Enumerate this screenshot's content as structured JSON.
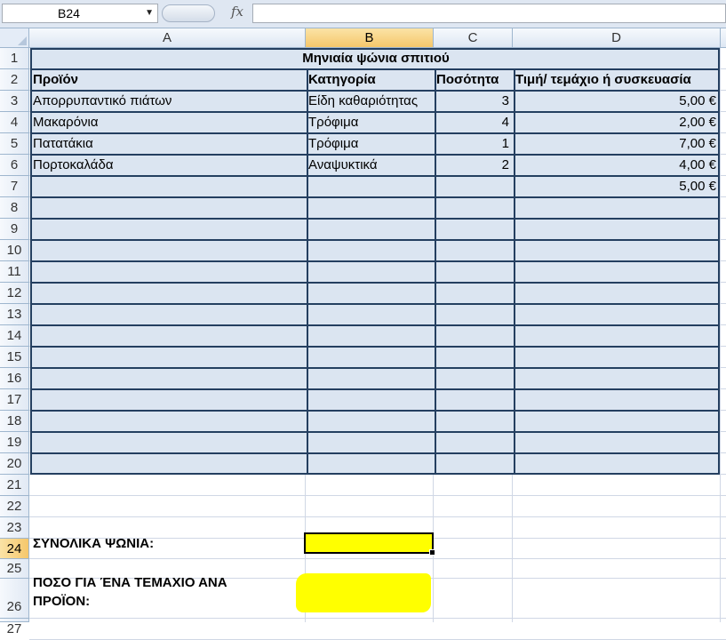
{
  "name_box": {
    "value": "B24",
    "dropdown_icon": "chevron-down-icon"
  },
  "formula_bar": {
    "fx_label": "fx",
    "content": ""
  },
  "columns": [
    "A",
    "B",
    "C",
    "D"
  ],
  "selected_column": "B",
  "rows": [
    "1",
    "2",
    "3",
    "4",
    "5",
    "6",
    "7",
    "8",
    "9",
    "10",
    "11",
    "12",
    "13",
    "14",
    "15",
    "16",
    "17",
    "18",
    "19",
    "20",
    "21",
    "22",
    "23",
    "24",
    "25",
    "26",
    "27"
  ],
  "selected_row": "24",
  "table": {
    "title": "Μηνιαία ψώνια σπιτιού",
    "headers": [
      "Προϊόν",
      "Κατηγορία",
      "Ποσότητα",
      "Τιμή/ τεμάχιο ή συσκευασία"
    ],
    "data": [
      [
        "Απορρυπαντικό πιάτων",
        "Είδη καθαριότητας",
        "3",
        "5,00 €"
      ],
      [
        "Μακαρόνια",
        "Τρόφιμα",
        "4",
        "2,00 €"
      ],
      [
        "Πατατάκια",
        "Τρόφιμα",
        "1",
        "7,00 €"
      ],
      [
        "Πορτοκαλάδα",
        "Αναψυκτικά",
        "2",
        "4,00 €"
      ],
      [
        "",
        "",
        "",
        "5,00 €"
      ]
    ]
  },
  "summary": {
    "total_label": "ΣΥΝΟΛΙΚΑ ΨΩΝΙΑ:",
    "per_item_line1": "ΠΟΣΟ ΓΙΑ ΈΝΑ ΤΕΜΑΧΙΟ ΑΝΑ",
    "per_item_line2": "ΠΡΟΪΟΝ:"
  },
  "colors": {
    "table_fill": "#dbe5f1",
    "table_border": "#243f60",
    "highlight": "#ffff00",
    "selected_header": "#f5c76b"
  }
}
